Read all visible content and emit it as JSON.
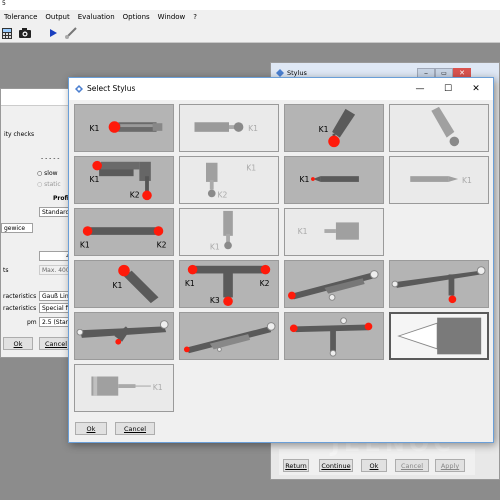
{
  "app": {
    "title_fragment": "5",
    "menu": [
      "Tolerance",
      "Output",
      "Evaluation",
      "Options",
      "Window",
      "?"
    ]
  },
  "left_window": {
    "labels": {
      "ity_checks": "ity checks",
      "slow": "slow",
      "static": "static",
      "profil": "Profil",
      "standard_field": "Standard (",
      "gewice": "gewice",
      "field_4a": "4",
      "field_4b": "4",
      "max": "Max. 400",
      "ts": "ts",
      "characteristics1": "racteristics",
      "characteristics2": "racteristics",
      "pm": "pm",
      "gauss": "Gauß Linea",
      "special": "Special filte",
      "standard_25": "2.5 (Stand"
    },
    "buttons": {
      "ok": "Ok",
      "cancel": "Cancel"
    }
  },
  "stylus_window": {
    "title": "Stylus",
    "buttons": [
      "Return",
      "Continue",
      "Ok",
      "Cancel",
      "Apply"
    ],
    "watermark": "JEENOC"
  },
  "dialog": {
    "title": "Select Stylus",
    "ok_label": "Ok",
    "cancel_label": "Cancel",
    "labels": {
      "k1": "K1",
      "k2": "K2",
      "k3": "K3"
    }
  },
  "colors": {
    "probe_tip": "#ff1a0a",
    "inactive_tip": "#8a8a8a",
    "body": "#5a5a5a"
  },
  "icons": [
    "calculator-icon",
    "camera-icon",
    "play-icon",
    "probe-icon",
    "minimize-icon",
    "maximize-icon",
    "close-icon",
    "stylus-app-icon"
  ]
}
